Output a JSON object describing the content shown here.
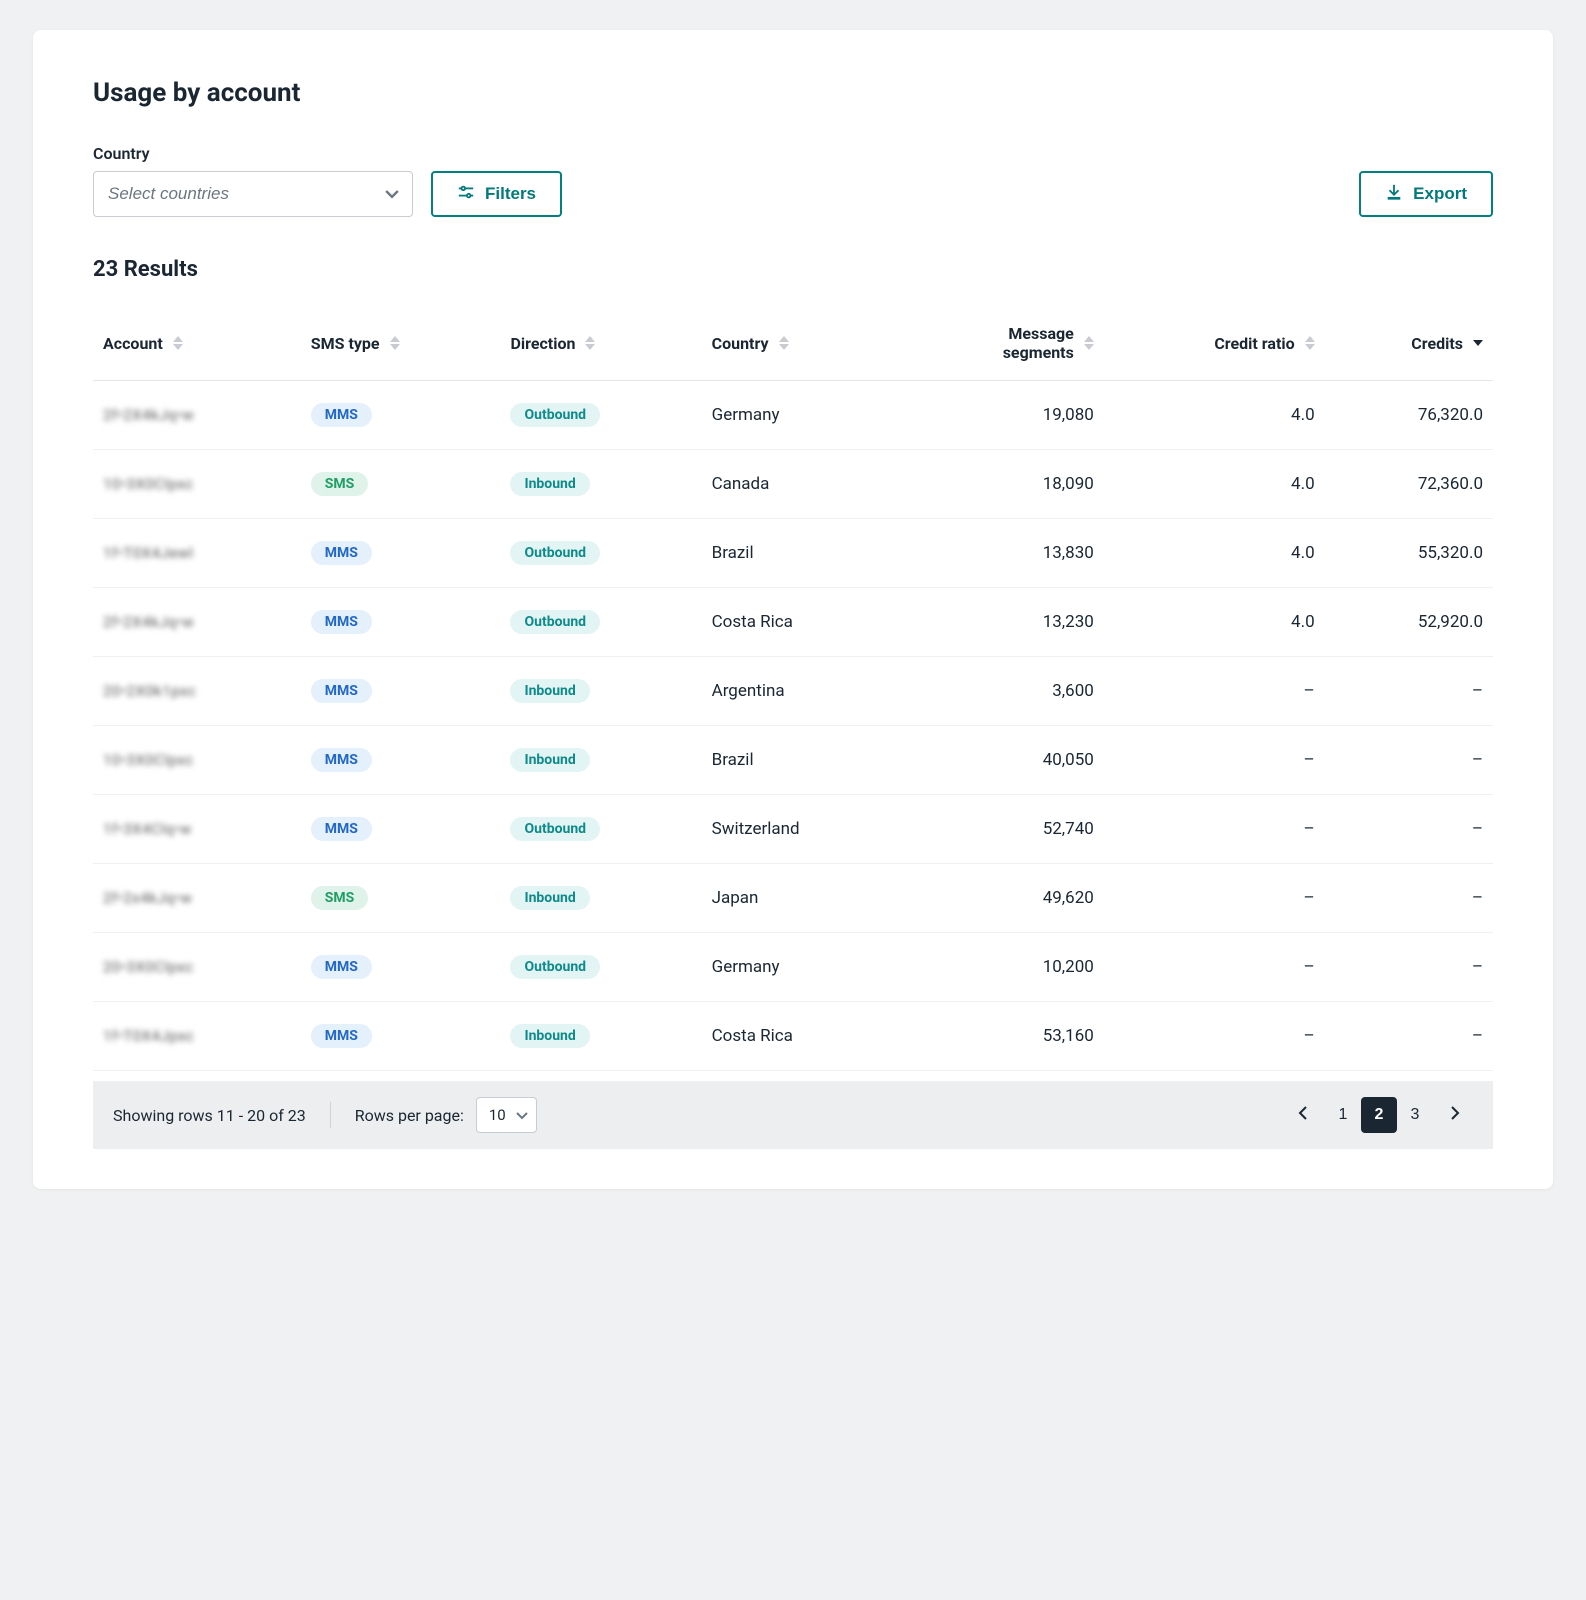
{
  "title": "Usage by account",
  "country_filter": {
    "label": "Country",
    "placeholder": "Select countries"
  },
  "filters_button": "Filters",
  "export_button": "Export",
  "results_label": "23 Results",
  "columns": {
    "account": "Account",
    "sms_type": "SMS type",
    "direction": "Direction",
    "country": "Country",
    "message_segments": "Message\nsegments",
    "credit_ratio": "Credit ratio",
    "credits": "Credits"
  },
  "rows": [
    {
      "account": "2f•2X4kJq•w",
      "sms_type": "MMS",
      "direction": "Outbound",
      "country": "Germany",
      "segments": "19,080",
      "ratio": "4.0",
      "credits": "76,320.0"
    },
    {
      "account": "10•3X0Clpxc",
      "sms_type": "SMS",
      "direction": "Inbound",
      "country": "Canada",
      "segments": "18,090",
      "ratio": "4.0",
      "credits": "72,360.0"
    },
    {
      "account": "1f•T0X4Jewl",
      "sms_type": "MMS",
      "direction": "Outbound",
      "country": "Brazil",
      "segments": "13,830",
      "ratio": "4.0",
      "credits": "55,320.0"
    },
    {
      "account": "2f•2X4kJq•w",
      "sms_type": "MMS",
      "direction": "Outbound",
      "country": "Costa Rica",
      "segments": "13,230",
      "ratio": "4.0",
      "credits": "52,920.0"
    },
    {
      "account": "20•2X0k1pxc",
      "sms_type": "MMS",
      "direction": "Inbound",
      "country": "Argentina",
      "segments": "3,600",
      "ratio": "–",
      "credits": "–"
    },
    {
      "account": "10•3X0Clpxc",
      "sms_type": "MMS",
      "direction": "Inbound",
      "country": "Brazil",
      "segments": "40,050",
      "ratio": "–",
      "credits": "–"
    },
    {
      "account": "1f•3X4Clq•w",
      "sms_type": "MMS",
      "direction": "Outbound",
      "country": "Switzerland",
      "segments": "52,740",
      "ratio": "–",
      "credits": "–"
    },
    {
      "account": "2f•2x4kJq•w",
      "sms_type": "SMS",
      "direction": "Inbound",
      "country": "Japan",
      "segments": "49,620",
      "ratio": "–",
      "credits": "–"
    },
    {
      "account": "20•3X0Clpxc",
      "sms_type": "MMS",
      "direction": "Outbound",
      "country": "Germany",
      "segments": "10,200",
      "ratio": "–",
      "credits": "–"
    },
    {
      "account": "1f•T0X4Jpxc",
      "sms_type": "MMS",
      "direction": "Inbound",
      "country": "Costa Rica",
      "segments": "53,160",
      "ratio": "–",
      "credits": "–"
    }
  ],
  "pagination": {
    "showing": "Showing rows 11 - 20 of 23",
    "rows_per_page_label": "Rows per page:",
    "rows_per_page_value": "10",
    "pages": [
      "1",
      "2",
      "3"
    ],
    "current_page": "2"
  }
}
